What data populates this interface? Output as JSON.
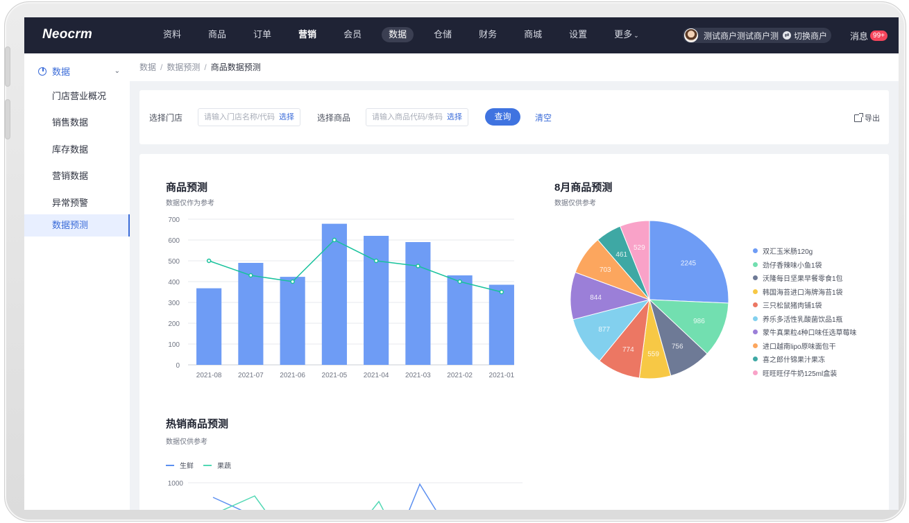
{
  "topbar": {
    "logo": "Neocrm",
    "nav": [
      {
        "label": "资料",
        "style": "normal"
      },
      {
        "label": "商品",
        "style": "normal"
      },
      {
        "label": "订单",
        "style": "normal"
      },
      {
        "label": "营销",
        "style": "bold"
      },
      {
        "label": "会员",
        "style": "normal"
      },
      {
        "label": "数据",
        "style": "active"
      },
      {
        "label": "仓储",
        "style": "normal"
      },
      {
        "label": "财务",
        "style": "normal"
      },
      {
        "label": "商城",
        "style": "normal"
      },
      {
        "label": "设置",
        "style": "normal"
      },
      {
        "label": "更多",
        "style": "more"
      }
    ],
    "merchant_name": "测试商户测试商户测试商户",
    "switch_label": "切换商户",
    "message_label": "消息",
    "message_badge": "99+"
  },
  "sidebar": {
    "section": "数据",
    "items": [
      "门店营业概况",
      "销售数据",
      "库存数据",
      "营销数据",
      "异常预警",
      "数据预测"
    ],
    "active_index": 5
  },
  "breadcrumb": [
    "数据",
    "数据预测",
    "商品数据预测"
  ],
  "filter": {
    "store_label": "选择门店",
    "store_placeholder": "请输入门店名称/代码",
    "store_pick": "选择",
    "goods_label": "选择商品",
    "goods_placeholder": "请输入商品代码/条码",
    "goods_pick": "选择",
    "query_label": "查询",
    "clear_label": "清空",
    "export_label": "导出"
  },
  "colors": {
    "accent": "#3f73e0",
    "nav_bg": "#1f2335",
    "bar": "#6e9cf5",
    "line": "#18c29c"
  },
  "charts": {
    "forecast_title": "商品预测",
    "forecast_sub": "数据仅作为参考",
    "pie_title": "8月商品预测",
    "pie_sub": "数据仅供参考",
    "hot_title": "热销商品预测",
    "hot_sub": "数据仅供参考"
  },
  "chart_data": [
    {
      "type": "bar",
      "title": "商品预测",
      "categories": [
        "2021-08",
        "2021-07",
        "2021-06",
        "2021-05",
        "2021-04",
        "2021-03",
        "2021-02",
        "2021-01"
      ],
      "series": [
        {
          "kind": "bar",
          "values": [
            368,
            490,
            423,
            678,
            620,
            590,
            430,
            385
          ]
        },
        {
          "kind": "line",
          "values": [
            500,
            430,
            400,
            600,
            500,
            475,
            400,
            350
          ]
        }
      ],
      "ylim": [
        0,
        700
      ],
      "yticks": [
        0,
        100,
        200,
        300,
        400,
        500,
        600,
        700
      ],
      "grid": true
    },
    {
      "type": "pie",
      "title": "8月商品预测",
      "legend_position": "right",
      "slices": [
        {
          "name": "双汇玉米肠120g",
          "value": 2245,
          "color": "#6e9cf5"
        },
        {
          "name": "劲仔香辣味小鱼1袋",
          "value": 986,
          "color": "#72dfb0"
        },
        {
          "name": "沃隆每日坚果早餐零食1包",
          "value": 756,
          "color": "#6e7a96"
        },
        {
          "name": "韩国海苔进口海牌海苔1袋",
          "value": 559,
          "color": "#f7c845"
        },
        {
          "name": "三只松鼠猪肉铺1袋",
          "value": 774,
          "color": "#ec7763"
        },
        {
          "name": "养乐多活性乳酸菌饮品1瓶",
          "value": 877,
          "color": "#82d0ee"
        },
        {
          "name": "蒙牛真果粒4种口味任选草莓味",
          "value": 844,
          "color": "#9b7fd8"
        },
        {
          "name": "进口越南lipo原味面包干",
          "value": 703,
          "color": "#fca65e"
        },
        {
          "name": "喜之郎什锦果汁果冻",
          "value": 461,
          "color": "#3ea8a4"
        },
        {
          "name": "旺旺旺仔牛奶125ml盒装",
          "value": 529,
          "color": "#f9a2c8"
        }
      ]
    },
    {
      "type": "line",
      "title": "热销商品预测",
      "legend_position": "top-left",
      "yticks": [
        1000
      ],
      "series": [
        {
          "name": "生鲜",
          "color": "#5b8ff0"
        },
        {
          "name": "果蔬",
          "color": "#52d8b4"
        }
      ]
    }
  ]
}
